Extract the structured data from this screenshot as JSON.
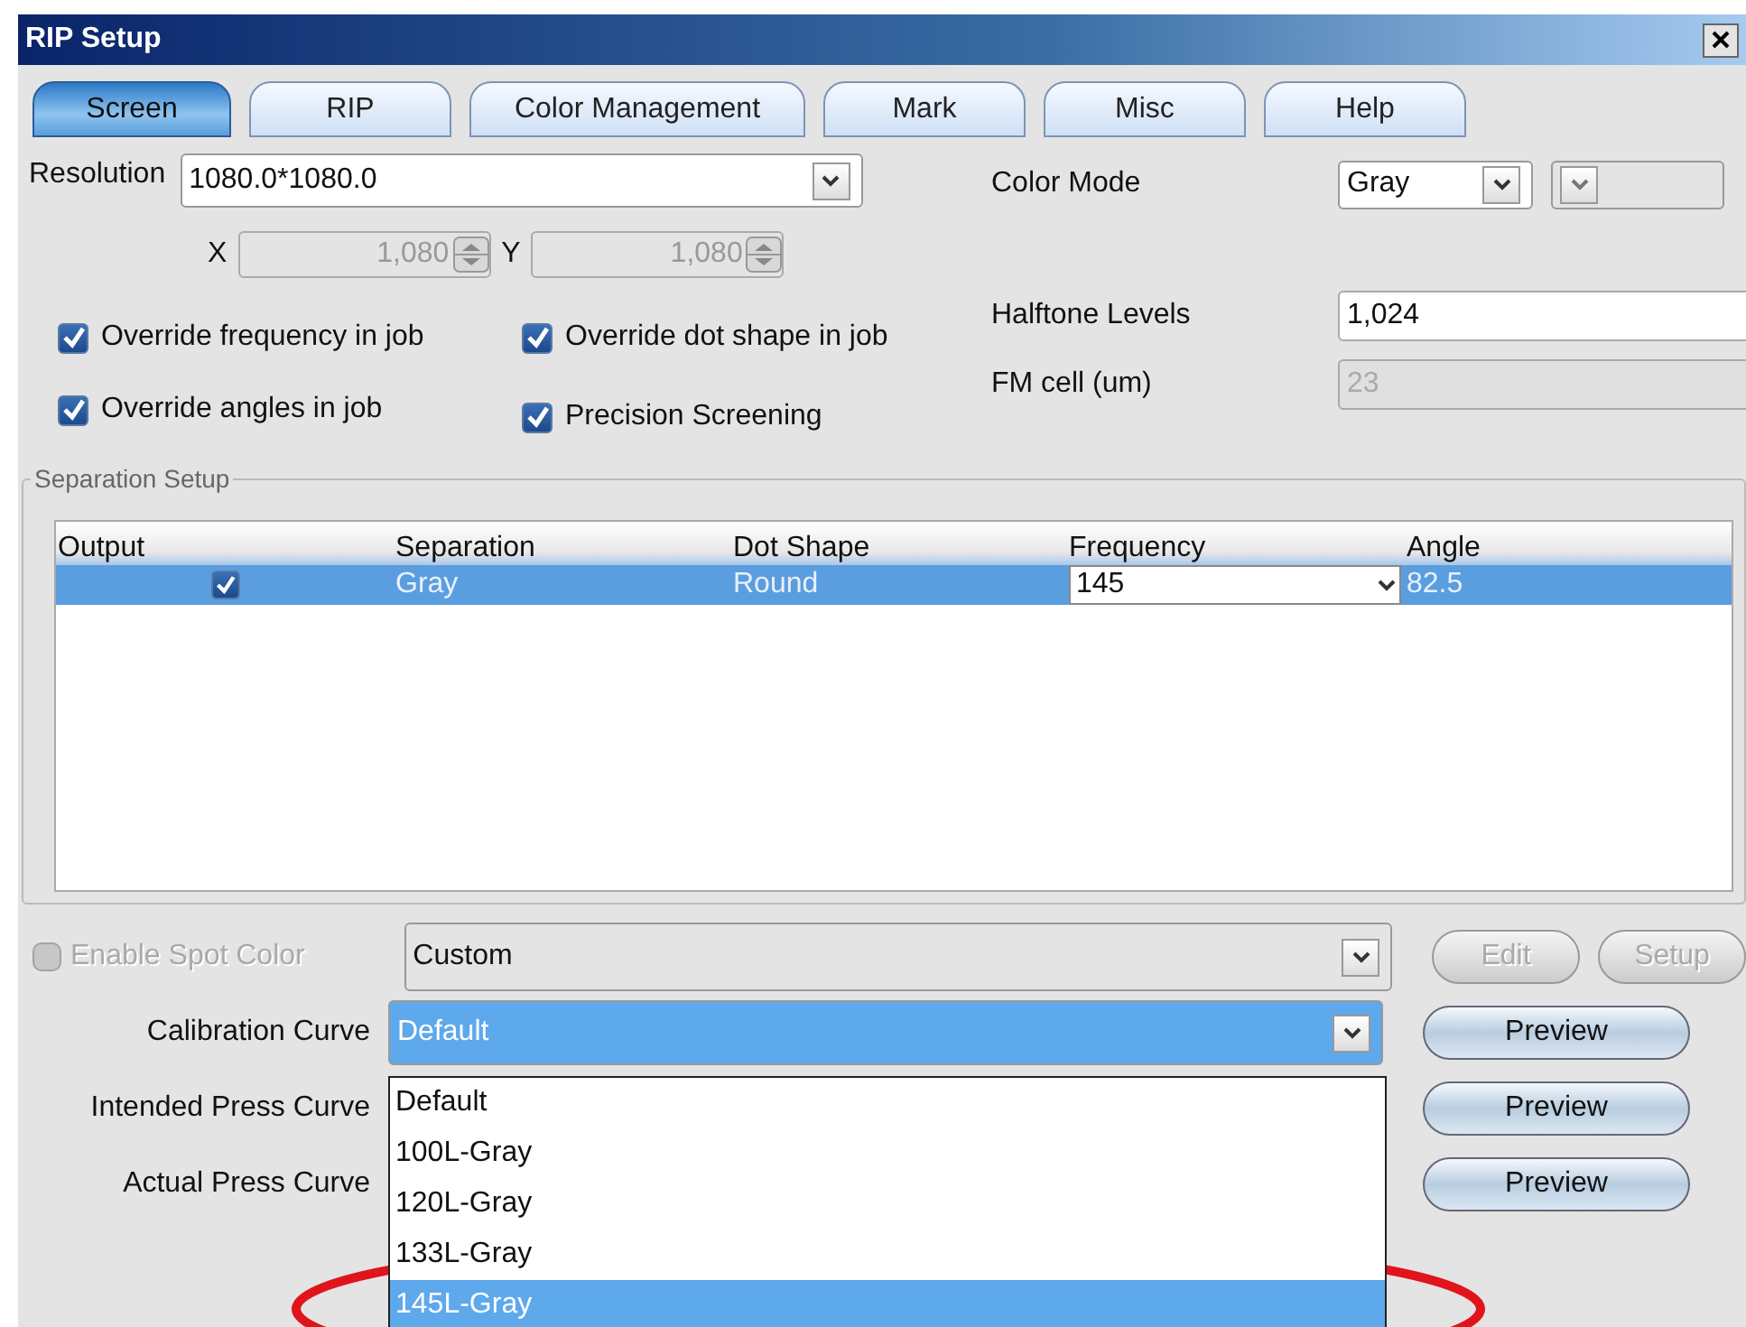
{
  "window": {
    "title": "RIP Setup"
  },
  "tabs": [
    {
      "label": "Screen",
      "selected": true
    },
    {
      "label": "RIP",
      "selected": false
    },
    {
      "label": "Color Management",
      "selected": false
    },
    {
      "label": "Mark",
      "selected": false
    },
    {
      "label": "Misc",
      "selected": false
    },
    {
      "label": "Help",
      "selected": false
    }
  ],
  "resolution": {
    "label": "Resolution",
    "value": "1080.0*1080.0"
  },
  "resolution_xy": [
    {
      "label": "X",
      "value": "1,080",
      "disabled": true
    },
    {
      "label": "Y",
      "value": "1,080",
      "disabled": true
    }
  ],
  "options": [
    {
      "label": "Override frequency in job",
      "checked": true
    },
    {
      "label": "Override dot shape in job",
      "checked": true
    },
    {
      "label": "Override angles in job",
      "checked": true
    },
    {
      "label": "Precision Screening",
      "checked": true
    }
  ],
  "color_mode": {
    "label": "Color Mode",
    "value": "Gray"
  },
  "halftone_levels": {
    "label": "Halftone Levels",
    "value": "1,024",
    "disabled": false
  },
  "fm_cell": {
    "label": "FM cell (um)",
    "value": "23",
    "disabled": true
  },
  "separation_setup": {
    "title": "Separation Setup",
    "columns": [
      "Output",
      "Separation",
      "Dot Shape",
      "Frequency",
      "Angle"
    ],
    "rows": [
      {
        "output_checked": true,
        "separation": "Gray",
        "dot_shape": "Round",
        "frequency": "145",
        "angle": "82.5",
        "selected": true
      }
    ]
  },
  "spot_color": {
    "label": "Enable Spot Color",
    "checked": false,
    "disabled": true,
    "value": "Custom",
    "buttons": [
      {
        "label": "Edit",
        "disabled": true
      },
      {
        "label": "Setup",
        "disabled": true
      }
    ]
  },
  "curves": [
    {
      "label": "Calibration Curve",
      "value": "Default",
      "focused": true,
      "button": "Preview"
    },
    {
      "label": "Intended Press Curve",
      "button": "Preview"
    },
    {
      "label": "Actual Press Curve",
      "button": "Preview"
    }
  ],
  "dropdown": {
    "items": [
      {
        "label": "Default",
        "selected": false
      },
      {
        "label": "100L-Gray",
        "selected": false
      },
      {
        "label": "120L-Gray",
        "selected": false
      },
      {
        "label": "133L-Gray",
        "selected": false
      },
      {
        "label": "145L-Gray",
        "selected": true
      }
    ]
  }
}
